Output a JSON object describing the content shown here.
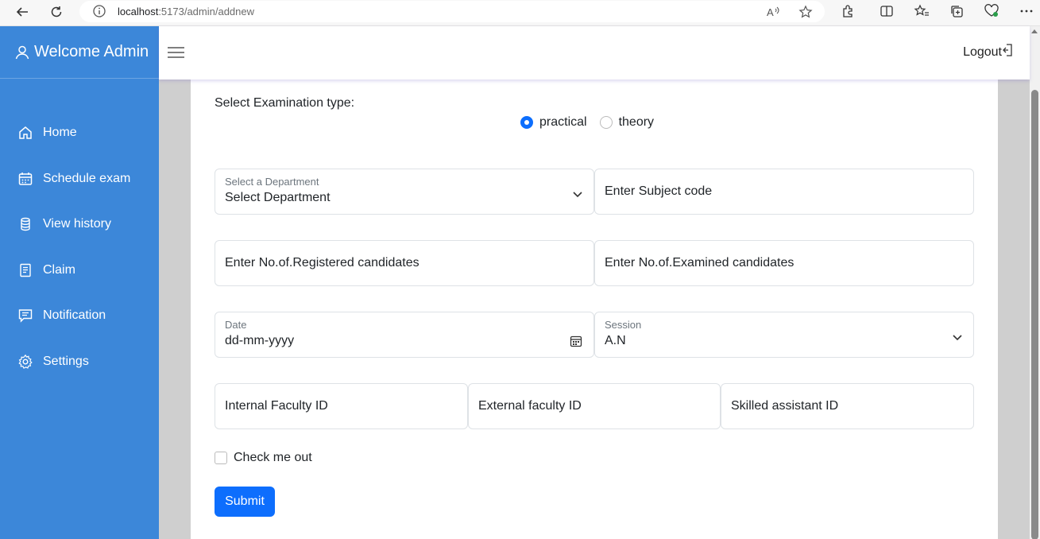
{
  "browser": {
    "url_host": "localhost",
    "url_rest": ":5173/admin/addnew"
  },
  "sidebar": {
    "brand": "Welcome Admin",
    "items": [
      {
        "label": "Home",
        "icon": "home-icon"
      },
      {
        "label": "Schedule exam",
        "icon": "calendar-icon"
      },
      {
        "label": "View history",
        "icon": "database-icon"
      },
      {
        "label": "Claim",
        "icon": "receipt-icon"
      },
      {
        "label": "Notification",
        "icon": "message-icon"
      },
      {
        "label": "Settings",
        "icon": "gear-icon"
      }
    ],
    "color": "#3c87d9"
  },
  "header": {
    "logout": "Logout"
  },
  "form": {
    "exam_type_label": "Select Examination type:",
    "exam_types": [
      "practical",
      "theory"
    ],
    "selected_exam_type": "practical",
    "department": {
      "label": "Select a Department",
      "value": "Select Department"
    },
    "subject_code": {
      "placeholder": "Enter Subject code"
    },
    "registered": {
      "placeholder": "Enter No.of.Registered candidates"
    },
    "examined": {
      "placeholder": "Enter No.of.Examined candidates"
    },
    "date": {
      "label": "Date",
      "value": "dd-mm-yyyy"
    },
    "session": {
      "label": "Session",
      "value": "A.N"
    },
    "internal_faculty": {
      "placeholder": "Internal Faculty ID"
    },
    "external_faculty": {
      "placeholder": "External faculty ID"
    },
    "skilled_assistant": {
      "placeholder": "Skilled assistant ID"
    },
    "check_label": "Check me out",
    "submit_label": "Submit",
    "accent": "#0d6efd"
  }
}
